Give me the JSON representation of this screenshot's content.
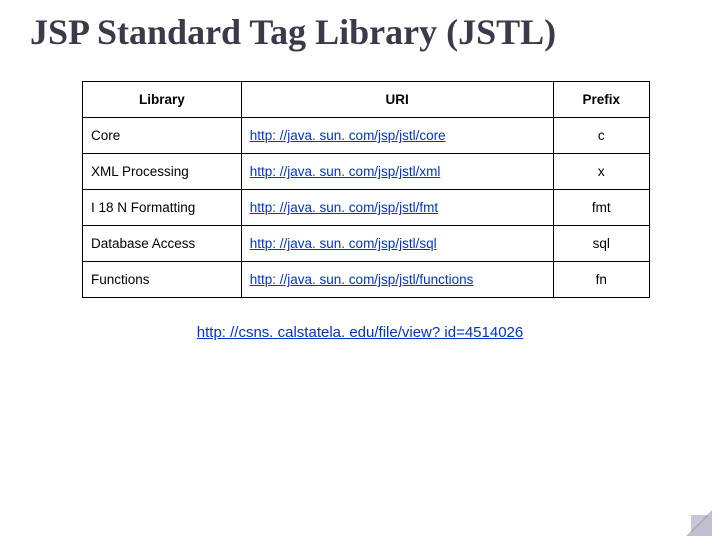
{
  "title": "JSP Standard Tag Library (JSTL)",
  "headers": {
    "library": "Library",
    "uri": "URI",
    "prefix": "Prefix"
  },
  "rows": [
    {
      "library": "Core",
      "uri": "http: //java. sun. com/jsp/jstl/core",
      "prefix": "c"
    },
    {
      "library": "XML Processing",
      "uri": "http: //java. sun. com/jsp/jstl/xml",
      "prefix": "x"
    },
    {
      "library": "I 18 N Formatting",
      "uri": "http: //java. sun. com/jsp/jstl/fmt",
      "prefix": "fmt"
    },
    {
      "library": "Database Access",
      "uri": "http: //java. sun. com/jsp/jstl/sql",
      "prefix": "sql"
    },
    {
      "library": "Functions",
      "uri": "http: //java. sun. com/jsp/jstl/functions",
      "prefix": "fn"
    }
  ],
  "footer_link": "http: //csns. calstatela. edu/file/view? id=4514026"
}
